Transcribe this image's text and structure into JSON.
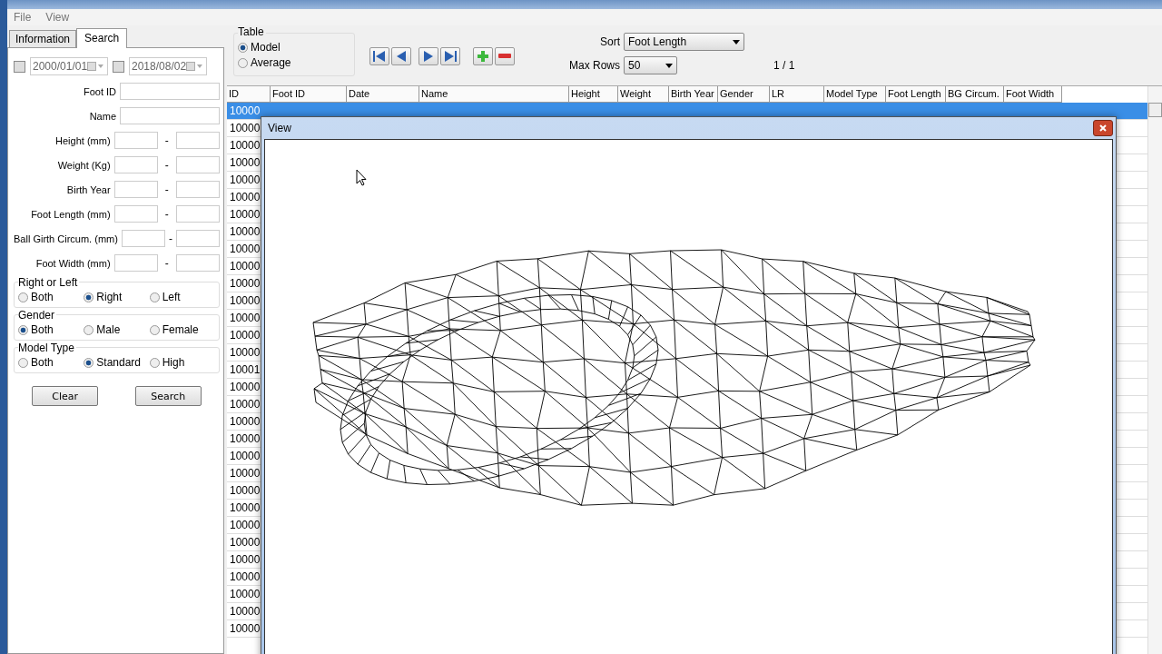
{
  "menu": [
    "File",
    "View"
  ],
  "tabs": [
    {
      "label": "Information",
      "selected": false
    },
    {
      "label": "Search",
      "selected": true
    }
  ],
  "date_filters": [
    {
      "checked": false,
      "value": "2000/01/01"
    },
    {
      "checked": false,
      "value": "2018/08/02"
    }
  ],
  "fields": [
    {
      "label": "Foot ID",
      "kind": "single"
    },
    {
      "label": "Name",
      "kind": "single"
    },
    {
      "label": "Height (mm)",
      "kind": "range",
      "separator": "-"
    },
    {
      "label": "Weight (Kg)",
      "kind": "range",
      "separator": "-"
    },
    {
      "label": "Birth Year",
      "kind": "range",
      "separator": "-"
    },
    {
      "label": "Foot Length (mm)",
      "kind": "range",
      "separator": "-"
    },
    {
      "label": "Ball Girth Circum. (mm)",
      "kind": "range",
      "separator": "-"
    },
    {
      "label": "Foot Width (mm)",
      "kind": "range",
      "separator": "-"
    }
  ],
  "radio_groups": [
    {
      "title": "Right or Left",
      "options": [
        {
          "label": "Both",
          "selected": false
        },
        {
          "label": "Right",
          "selected": true
        },
        {
          "label": "Left",
          "selected": false
        }
      ]
    },
    {
      "title": "Gender",
      "options": [
        {
          "label": "Both",
          "selected": true
        },
        {
          "label": "Male",
          "selected": false
        },
        {
          "label": "Female",
          "selected": false
        }
      ]
    },
    {
      "title": "Model Type",
      "options": [
        {
          "label": "Both",
          "selected": false
        },
        {
          "label": "Standard",
          "selected": true
        },
        {
          "label": "High",
          "selected": false
        }
      ]
    }
  ],
  "buttons": [
    "Clear",
    "Search"
  ],
  "table_group": {
    "title": "Table",
    "options": [
      {
        "label": "Model",
        "selected": true
      },
      {
        "label": "Average",
        "selected": false
      }
    ]
  },
  "sort": {
    "label": "Sort",
    "value": "Foot Length"
  },
  "max_rows": {
    "label": "Max Rows",
    "value": "50"
  },
  "page": "1 / 1",
  "table": {
    "columns": [
      "ID",
      "Foot ID",
      "Date",
      "Name",
      "Height",
      "Weight",
      "Birth Year",
      "Gender",
      "LR",
      "Model Type",
      "Foot Length",
      "BG Circum.",
      "Foot Width"
    ],
    "rows": [
      {
        "id": "10000",
        "selected": true
      },
      {
        "id": "10000",
        "selected": false
      },
      {
        "id": "10000",
        "selected": false
      },
      {
        "id": "10000",
        "selected": false
      },
      {
        "id": "10000",
        "selected": false
      },
      {
        "id": "10000",
        "selected": false
      },
      {
        "id": "10000",
        "selected": false
      },
      {
        "id": "10000",
        "selected": false
      },
      {
        "id": "10000",
        "selected": false
      },
      {
        "id": "10000",
        "selected": false
      },
      {
        "id": "10000",
        "selected": false
      },
      {
        "id": "10000",
        "selected": false
      },
      {
        "id": "10000",
        "selected": false
      },
      {
        "id": "10000",
        "selected": false
      },
      {
        "id": "10000",
        "selected": false
      },
      {
        "id": "10001",
        "selected": false
      },
      {
        "id": "10000",
        "selected": false
      },
      {
        "id": "10000",
        "selected": false
      },
      {
        "id": "10000",
        "selected": false
      },
      {
        "id": "10000",
        "selected": false
      },
      {
        "id": "10000",
        "selected": false
      },
      {
        "id": "10000",
        "selected": false
      },
      {
        "id": "10000",
        "selected": false
      },
      {
        "id": "10000",
        "selected": false
      },
      {
        "id": "10000",
        "selected": false
      },
      {
        "id": "10000",
        "selected": false
      },
      {
        "id": "10000",
        "selected": false
      },
      {
        "id": "10000",
        "selected": false
      },
      {
        "id": "10000",
        "selected": false
      },
      {
        "id": "10000",
        "selected": false
      },
      {
        "id": "10000",
        "selected": false
      }
    ]
  },
  "view_window": {
    "title": "View"
  }
}
